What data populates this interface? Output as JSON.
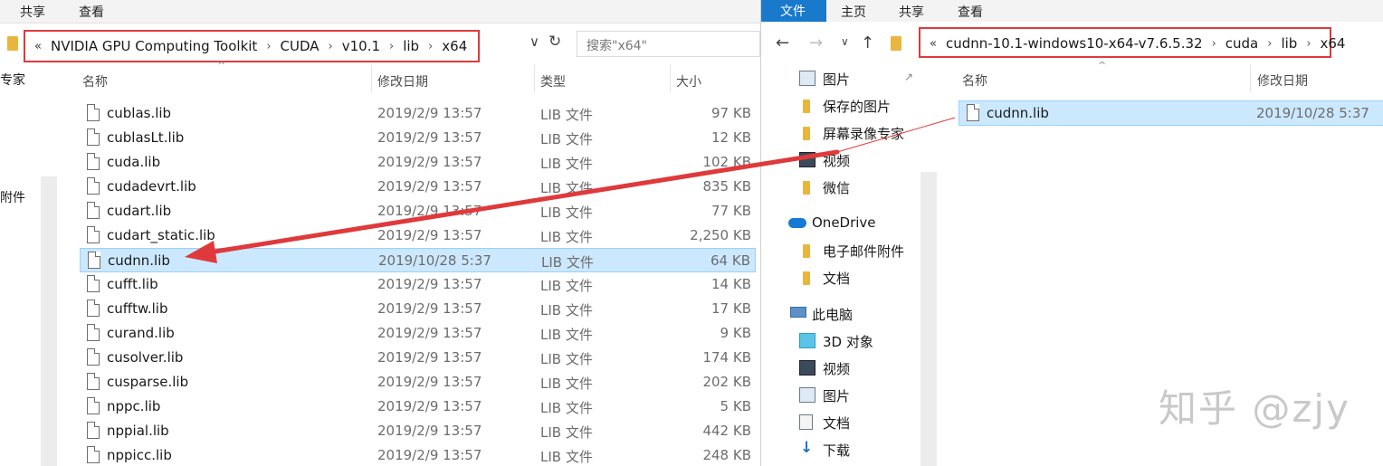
{
  "left": {
    "ribbon_tabs": [
      "共享",
      "查看"
    ],
    "address": {
      "lead": "«",
      "crumbs": [
        "NVIDIA GPU Computing Toolkit",
        "CUDA",
        "v10.1",
        "lib",
        "x64"
      ]
    },
    "search_placeholder": "搜索\"x64\"",
    "nav_partial": [
      "专家",
      "附件"
    ],
    "columns": {
      "name": "名称",
      "date": "修改日期",
      "type": "类型",
      "size": "大小"
    },
    "files": [
      {
        "name": "cublas.lib",
        "date": "2019/2/9 13:57",
        "type": "LIB 文件",
        "size": "97 KB"
      },
      {
        "name": "cublasLt.lib",
        "date": "2019/2/9 13:57",
        "type": "LIB 文件",
        "size": "12 KB"
      },
      {
        "name": "cuda.lib",
        "date": "2019/2/9 13:57",
        "type": "LIB 文件",
        "size": "102 KB"
      },
      {
        "name": "cudadevrt.lib",
        "date": "2019/2/9 13:57",
        "type": "LIB 文件",
        "size": "835 KB"
      },
      {
        "name": "cudart.lib",
        "date": "2019/2/9 13:57",
        "type": "LIB 文件",
        "size": "77 KB"
      },
      {
        "name": "cudart_static.lib",
        "date": "2019/2/9 13:57",
        "type": "LIB 文件",
        "size": "2,250 KB"
      },
      {
        "name": "cudnn.lib",
        "date": "2019/10/28 5:37",
        "type": "LIB 文件",
        "size": "64 KB",
        "selected": true
      },
      {
        "name": "cufft.lib",
        "date": "2019/2/9 13:57",
        "type": "LIB 文件",
        "size": "14 KB"
      },
      {
        "name": "cufftw.lib",
        "date": "2019/2/9 13:57",
        "type": "LIB 文件",
        "size": "17 KB"
      },
      {
        "name": "curand.lib",
        "date": "2019/2/9 13:57",
        "type": "LIB 文件",
        "size": "9 KB"
      },
      {
        "name": "cusolver.lib",
        "date": "2019/2/9 13:57",
        "type": "LIB 文件",
        "size": "174 KB"
      },
      {
        "name": "cusparse.lib",
        "date": "2019/2/9 13:57",
        "type": "LIB 文件",
        "size": "202 KB"
      },
      {
        "name": "nppc.lib",
        "date": "2019/2/9 13:57",
        "type": "LIB 文件",
        "size": "5 KB"
      },
      {
        "name": "nppial.lib",
        "date": "2019/2/9 13:57",
        "type": "LIB 文件",
        "size": "442 KB"
      },
      {
        "name": "nppicc.lib",
        "date": "2019/2/9 13:57",
        "type": "LIB 文件",
        "size": "248 KB"
      }
    ]
  },
  "right": {
    "ribbon_tabs": [
      "文件",
      "主页",
      "共享",
      "查看"
    ],
    "address": {
      "lead": "«",
      "crumbs": [
        "cudnn-10.1-windows10-x64-v7.6.5.32",
        "cuda",
        "lib",
        "x64"
      ]
    },
    "nav": [
      {
        "label": "图片",
        "icon": "pictures-icon",
        "pinned": true
      },
      {
        "label": "保存的图片",
        "icon": "folder-icon"
      },
      {
        "label": "屏幕录像专家",
        "icon": "folder-icon"
      },
      {
        "label": "视频",
        "icon": "video-icon"
      },
      {
        "label": "微信",
        "icon": "folder-icon"
      },
      {
        "label": "OneDrive",
        "icon": "onedrive-icon"
      },
      {
        "label": "电子邮件附件",
        "icon": "folder-icon"
      },
      {
        "label": "文档",
        "icon": "folder-icon"
      },
      {
        "label": "此电脑",
        "icon": "computer-icon"
      },
      {
        "label": "3D 对象",
        "icon": "3d-objects-icon"
      },
      {
        "label": "视频",
        "icon": "video-icon"
      },
      {
        "label": "图片",
        "icon": "pictures-icon"
      },
      {
        "label": "文档",
        "icon": "documents-icon"
      },
      {
        "label": "下载",
        "icon": "download-icon"
      }
    ],
    "columns": {
      "name": "名称",
      "date": "修改日期"
    },
    "files": [
      {
        "name": "cudnn.lib",
        "date": "2019/10/28 5:37",
        "selected": true
      }
    ]
  },
  "watermark": "知乎 @zjy",
  "colors": {
    "highlight_box": "#e0393b",
    "selection": "#cce8ff",
    "file_tab": "#1979ca",
    "arrow": "#e0393b"
  }
}
